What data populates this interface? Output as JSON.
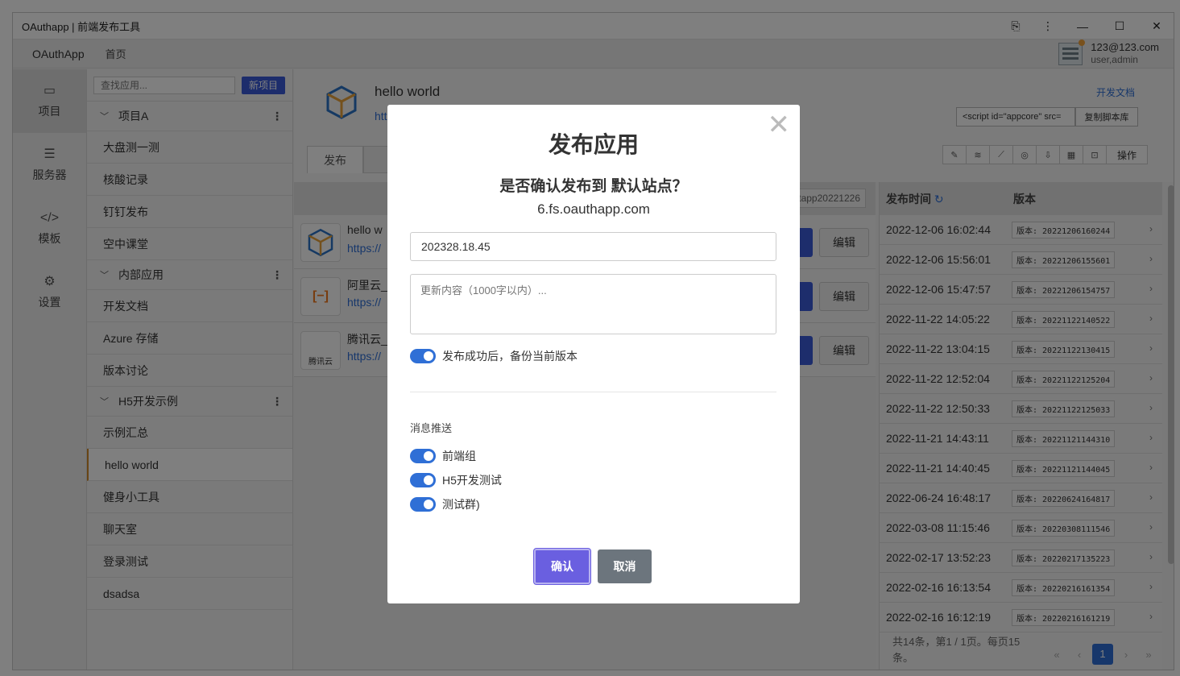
{
  "window": {
    "title": "OAuthapp | 前端发布工具",
    "controls": [
      "⎘",
      "⋮",
      "—",
      "☐",
      "✕"
    ]
  },
  "topnav": {
    "brand": "OAuthApp",
    "home": "首页",
    "user_email": "123@123.com",
    "user_role": "user,admin"
  },
  "leftnav": [
    {
      "icon": "project-icon",
      "glyph": "▭",
      "label": "项目"
    },
    {
      "icon": "server-icon",
      "glyph": "☰",
      "label": "服务器"
    },
    {
      "icon": "code-icon",
      "glyph": "</>",
      "label": "模板"
    },
    {
      "icon": "gear-icon",
      "glyph": "⚙",
      "label": "设置"
    }
  ],
  "applist": {
    "search_placeholder": "查找应用...",
    "new_button": "新项目",
    "groups": [
      {
        "name": "项目A",
        "items": [
          "大盘测一测",
          "核酸记录",
          "钉钉发布",
          "空中课堂"
        ]
      },
      {
        "name": "内部应用",
        "items": [
          "开发文档",
          "Azure 存储",
          "版本讨论"
        ]
      },
      {
        "name": "H5开发示例",
        "items": [
          "示例汇总",
          "hello world",
          "健身小工具",
          "聊天室",
          "登录测试",
          "dsadsa"
        ]
      }
    ],
    "selected": "hello world"
  },
  "app": {
    "name": "hello world",
    "url_fragment": "htt",
    "dev_doc": "开发文档",
    "script_snippet": "<script id=\"appcore\" src=",
    "copy_lib": "复制脚本库",
    "operate": "操作",
    "tab_publish": "发布",
    "tag": "stapp20221226"
  },
  "sites": [
    {
      "name": "hello w",
      "url": "https://",
      "logo": "cube-logo",
      "logo_text": ""
    },
    {
      "name": "阿里云_",
      "url": "https://",
      "logo": "aliyun-logo",
      "logo_text": "[−]"
    },
    {
      "name": "腾讯云_",
      "url": "https://",
      "logo": "tencent-cloud-logo",
      "logo_text": "腾讯云"
    }
  ],
  "site_edit_label": "编辑",
  "versions": {
    "col_time": "发布时间",
    "col_version": "版本",
    "rows": [
      {
        "time": "2022-12-06 16:02:44",
        "version": "版本: 20221206160244"
      },
      {
        "time": "2022-12-06 15:56:01",
        "version": "版本: 20221206155601"
      },
      {
        "time": "2022-12-06 15:47:57",
        "version": "版本: 20221206154757"
      },
      {
        "time": "2022-11-22 14:05:22",
        "version": "版本: 20221122140522"
      },
      {
        "time": "2022-11-22 13:04:15",
        "version": "版本: 20221122130415"
      },
      {
        "time": "2022-11-22 12:52:04",
        "version": "版本: 20221122125204"
      },
      {
        "time": "2022-11-22 12:50:33",
        "version": "版本: 20221122125033"
      },
      {
        "time": "2022-11-21 14:43:11",
        "version": "版本: 20221121144310"
      },
      {
        "time": "2022-11-21 14:40:45",
        "version": "版本: 20221121144045"
      },
      {
        "time": "2022-06-24 16:48:17",
        "version": "版本: 20220624164817"
      },
      {
        "time": "2022-03-08 11:15:46",
        "version": "版本: 20220308111546"
      },
      {
        "time": "2022-02-17 13:52:23",
        "version": "版本: 20220217135223"
      },
      {
        "time": "2022-02-16 16:13:54",
        "version": "版本: 20220216161354"
      },
      {
        "time": "2022-02-16 16:12:19",
        "version": "版本: 20220216161219"
      }
    ],
    "pager_info": "共14条，第1 / 1页。每页15条。",
    "current_page": "1"
  },
  "modal": {
    "title": "发布应用",
    "question": "是否确认发布到 默认站点？",
    "host": "6.fs.oauthapp.com",
    "version_value": "202328.18.45",
    "notes_placeholder": "更新内容（1000字以内）...",
    "backup_label": "发布成功后，备份当前版本",
    "push_title": "消息推送",
    "push_groups": [
      "前端组",
      "H5开发测试",
      "测试群)"
    ],
    "confirm": "确认",
    "cancel": "取消"
  },
  "colors": {
    "accent": "#2f6fd6",
    "confirm": "#6a5fe0",
    "cancel": "#6c757d",
    "new_button": "#3a5bd9"
  }
}
